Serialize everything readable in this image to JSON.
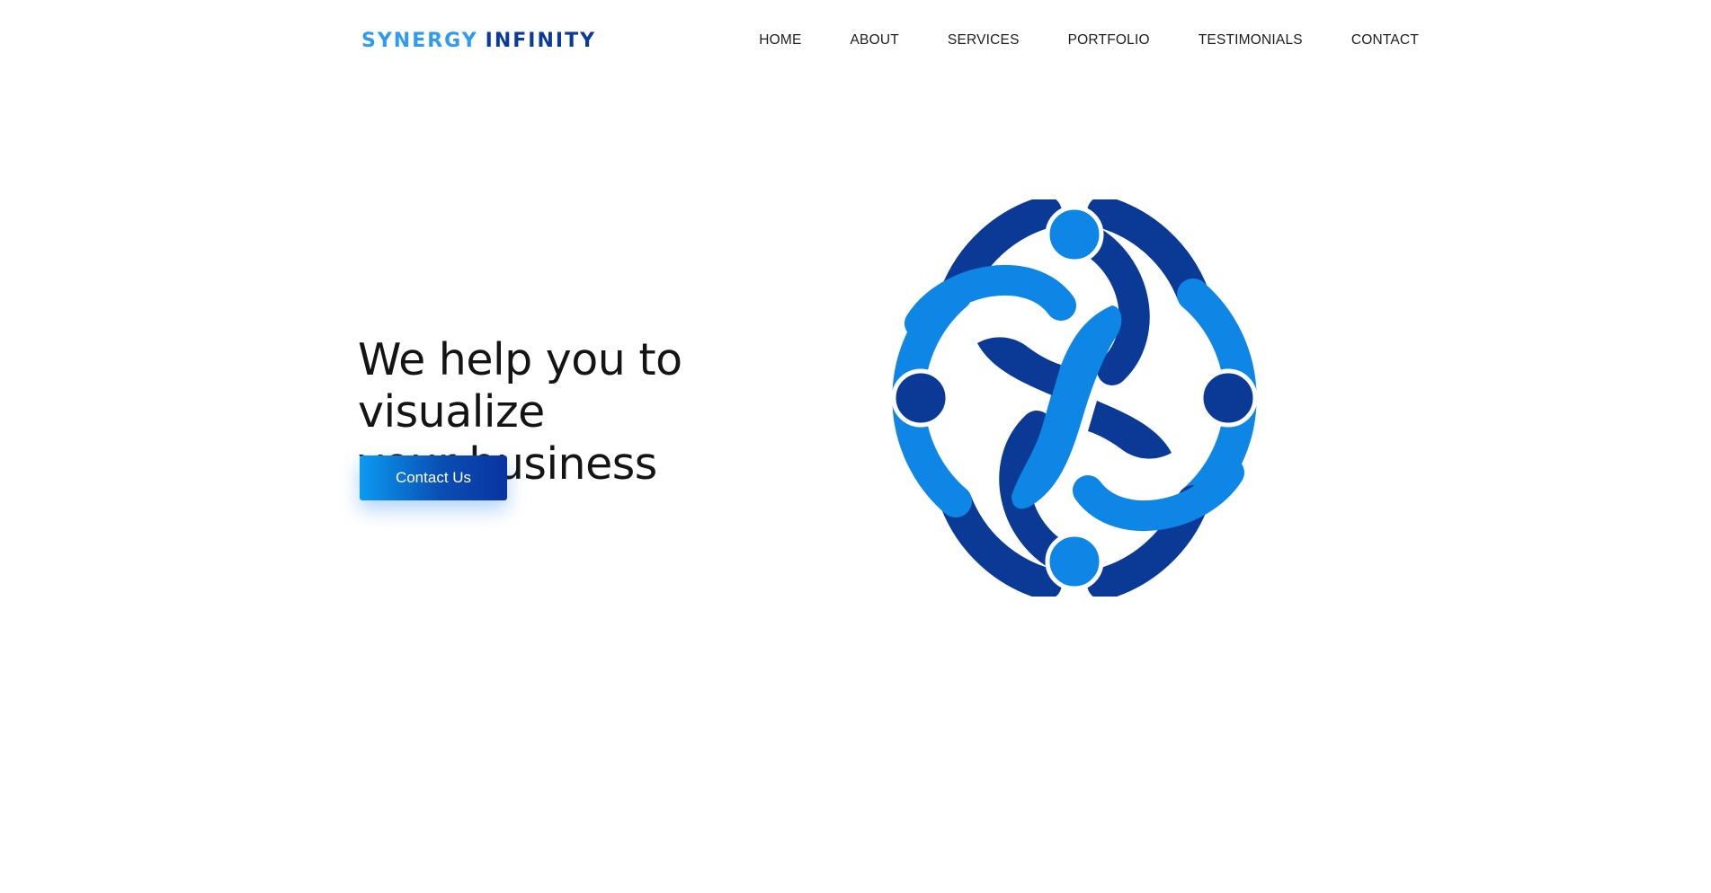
{
  "header": {
    "logo": {
      "word1": "SYNERGY",
      "word2": "INFINITY"
    },
    "nav": [
      {
        "label": "HOME"
      },
      {
        "label": "ABOUT"
      },
      {
        "label": "SERVICES"
      },
      {
        "label": "PORTFOLIO"
      },
      {
        "label": "TESTIMONIALS"
      },
      {
        "label": "CONTACT"
      }
    ]
  },
  "hero": {
    "title_line1": "We help you to visualize",
    "title_line2": "your business",
    "cta_label": "Contact Us",
    "illustration_icon": "team-circle-icon"
  },
  "colors": {
    "light_blue": "#0e86e6",
    "dark_blue": "#0a3a95",
    "logo_light": "#2e9bf0",
    "logo_dark": "#0a3b99",
    "text": "#141414"
  }
}
